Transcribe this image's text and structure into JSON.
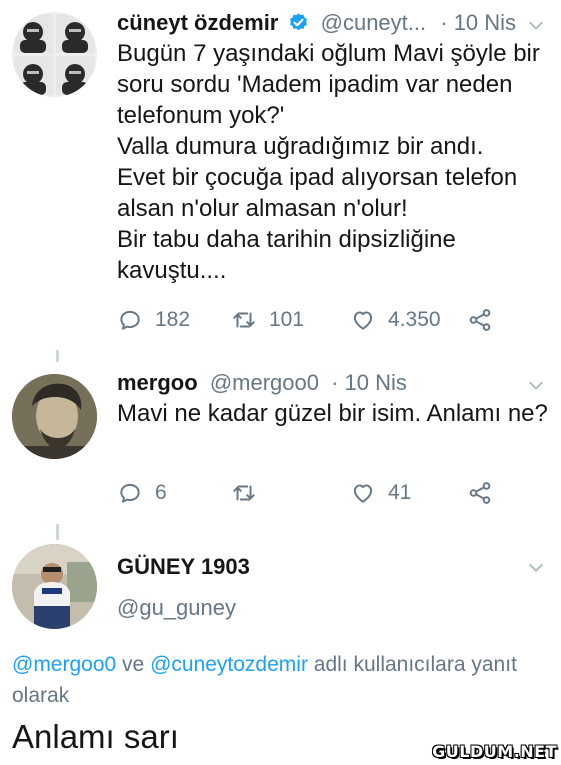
{
  "tweet1": {
    "name": "cüneyt özdemir",
    "handle": "@cuneyt...",
    "date": "· 10 Nis",
    "lines": [
      "Bugün 7 yaşındaki oğlum Mavi şöyle bir",
      "soru sordu 'Madem ipadim var neden",
      "telefonum yok?'",
      "Valla dumura uğradığımız bir andı.",
      "Evet bir çocuğa ipad alıyorsan telefon",
      "alsan n'olur almasan n'olur!",
      "Bir tabu daha tarihin dipsizliğine",
      "kavuştu...."
    ],
    "replies": "182",
    "retweets": "101",
    "likes": "4.350"
  },
  "tweet2": {
    "name": "mergoo",
    "handle": "@mergoo0",
    "date": "· 10 Nis",
    "text": "Mavi ne kadar güzel bir isim. Anlamı ne?",
    "replies": "6",
    "likes": "41"
  },
  "tweet3": {
    "name": "GÜNEY 1903",
    "handle": "@gu_guney",
    "reply_mention1": "@mergoo0",
    "reply_connector": " ve ",
    "reply_mention2": "@cuneytozdemir",
    "reply_suffix": " adlı kullanıcılara yanıt olarak",
    "text": "Anlamı sarı"
  },
  "watermark": "GULDUM.NET",
  "colors": {
    "accent": "#1da1f2",
    "verified": "#1da1f2",
    "secondary_text": "#657786"
  }
}
